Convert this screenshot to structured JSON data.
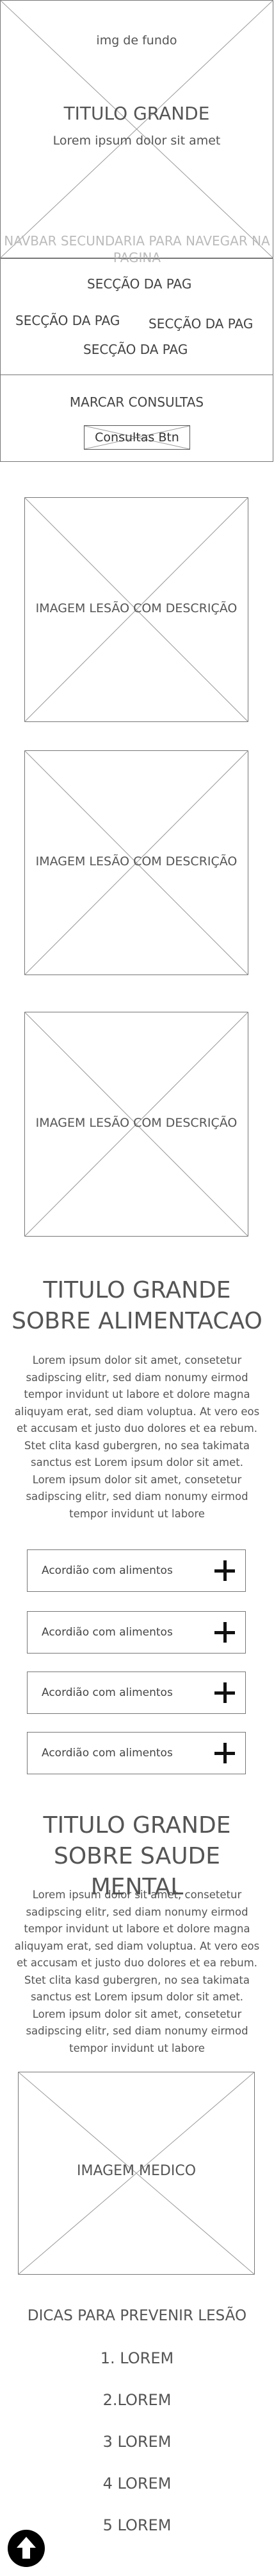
{
  "hero": {
    "bg_label": "img de fundo",
    "title": "TITULO GRANDE",
    "subtitle": "Lorem ipsum dolor sit amet"
  },
  "navbar": {
    "placeholder": "NAVBAR SECUNDARIA PARA NAVEGAR NA PAGINA",
    "links": [
      "SECÇÃO DA PAG",
      "SECÇÃO DA PAG",
      "SECÇÃO DA PAG",
      "SECÇÃO DA PAG"
    ]
  },
  "consultas": {
    "title": "MARCAR CONSULTAS",
    "button_label": "Consultas Btn"
  },
  "lesion_images": [
    {
      "label": "IMAGEM LESÃO COM DESCRIÇÃO"
    },
    {
      "label": "IMAGEM LESÃO COM DESCRIÇÃO"
    },
    {
      "label": "IMAGEM LESÃO COM DESCRIÇÃO"
    }
  ],
  "alimentacao": {
    "title": "TITULO GRANDE SOBRE ALIMENTACAO",
    "text": "Lorem ipsum dolor sit amet, consetetur sadipscing elitr, sed diam nonumy eirmod tempor invidunt ut labore et dolore magna aliquyam erat, sed diam voluptua. At vero eos et accusam et justo duo dolores et ea rebum. Stet clita kasd gubergren, no sea takimata sanctus est Lorem ipsum dolor sit amet. Lorem ipsum dolor sit amet, consetetur sadipscing elitr, sed diam nonumy eirmod tempor invidunt ut labore",
    "accordions": [
      "Acordião com alimentos",
      "Acordião com alimentos",
      "Acordião com alimentos",
      "Acordião com alimentos"
    ]
  },
  "saude_mental": {
    "title": "TITULO GRANDE SOBRE SAUDE MENTAL",
    "text": "Lorem ipsum dolor sit amet, consetetur sadipscing elitr, sed diam nonumy eirmod tempor invidunt ut labore et dolore magna aliquyam erat, sed diam voluptua. At vero eos et accusam et justo duo dolores et ea rebum. Stet clita kasd gubergren, no sea takimata sanctus est Lorem ipsum dolor sit amet. Lorem ipsum dolor sit amet, consetetur sadipscing elitr, sed diam nonumy eirmod tempor invidunt ut labore",
    "image_label": "IMAGEM MEDICO"
  },
  "dicas": {
    "title": "DICAS PARA PREVENIR LESÃO",
    "items": [
      "1. LOREM",
      "2.LOREM",
      "3 LOREM",
      "4 LOREM",
      "5 LOREM"
    ]
  },
  "scroll_top": {
    "icon": "arrow-up-icon"
  }
}
